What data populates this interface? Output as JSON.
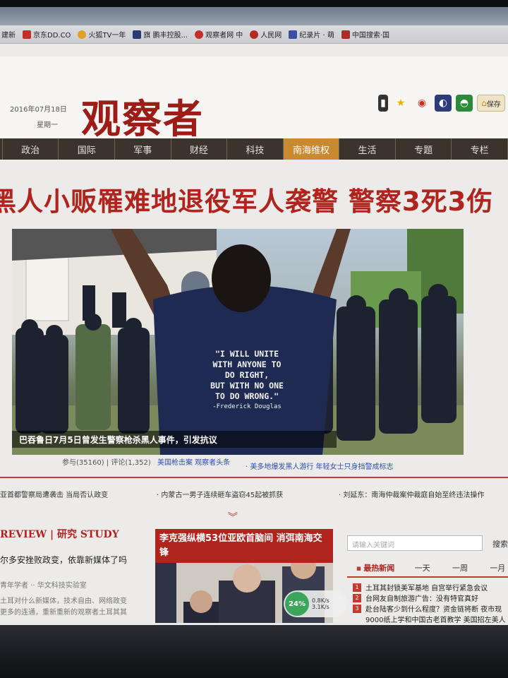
{
  "bookmarks": [
    "建新",
    "京东DD.CO",
    "火狐TV一年",
    "旗 鹏丰控股...",
    "观察者网 中",
    "人民网",
    "纪录片 · 萌",
    "中国搜索·国"
  ],
  "header": {
    "date": "2016年07月18日",
    "weekday": "星期一",
    "logo": "观察者",
    "save_label": "保存"
  },
  "nav": [
    "政治",
    "国际",
    "军事",
    "财经",
    "科技",
    "南海维权",
    "生活",
    "专题",
    "专栏"
  ],
  "nav_active_index": 5,
  "headline": "黑人小贩罹难地退役军人袭警 警察3死3伤",
  "photo": {
    "shirt_text": [
      "\"I WILL UNITE",
      "WITH ANYONE TO",
      "DO RIGHT,",
      "BUT WITH NO ONE",
      "TO DO WRONG.\"",
      "-Frederick Douglas"
    ],
    "caption": "巴吞鲁日7月5日曾发生警察枪杀黑人事件，引发抗议"
  },
  "meta": {
    "stats": "参与(35160) | 评论(1,352)",
    "link1": "美国枪击案 观察者头条",
    "link2": "· 美多地爆发黑人游行 年轻女士只身挡警成标志"
  },
  "news_row": [
    "亚首都警察局遭袭击 当局否认政变",
    "· 内蒙古一男子连续砸车盗窃45起被抓获",
    "· 刘延东：南海仲裁案仲裁庭自始至终违法操作"
  ],
  "review": {
    "title": "REVIEW | 研究 STUDY",
    "item": "尔多安挫败政变，依靠新媒体了吗",
    "sub1": "青年学者 ·· 华文科技实验室",
    "sub2": "土耳对什么新媒体，技术自由、网络政变",
    "sub3": "更多的连通，重新重新的观察者土耳其其"
  },
  "mid_story": {
    "title": "李克强纵横53位亚欧首脑间 消弭南海交锋"
  },
  "speed": {
    "percent": "24%",
    "up": "0.8K/s",
    "down": "3.1K/s"
  },
  "search": {
    "placeholder": "请输入关键词",
    "button": "搜索"
  },
  "hot": {
    "tabs": [
      "最热新闻",
      "一天",
      "一周",
      "一月"
    ],
    "items": [
      "土耳其封锁美军基地 自宫举行紧急会议",
      "台网友自制旅游广告：没有特官真好",
      "赴台陆客少到什么程度？资金链将断 夜市现",
      "9000纸上学和中国古老首教学 美国招左美人"
    ]
  }
}
